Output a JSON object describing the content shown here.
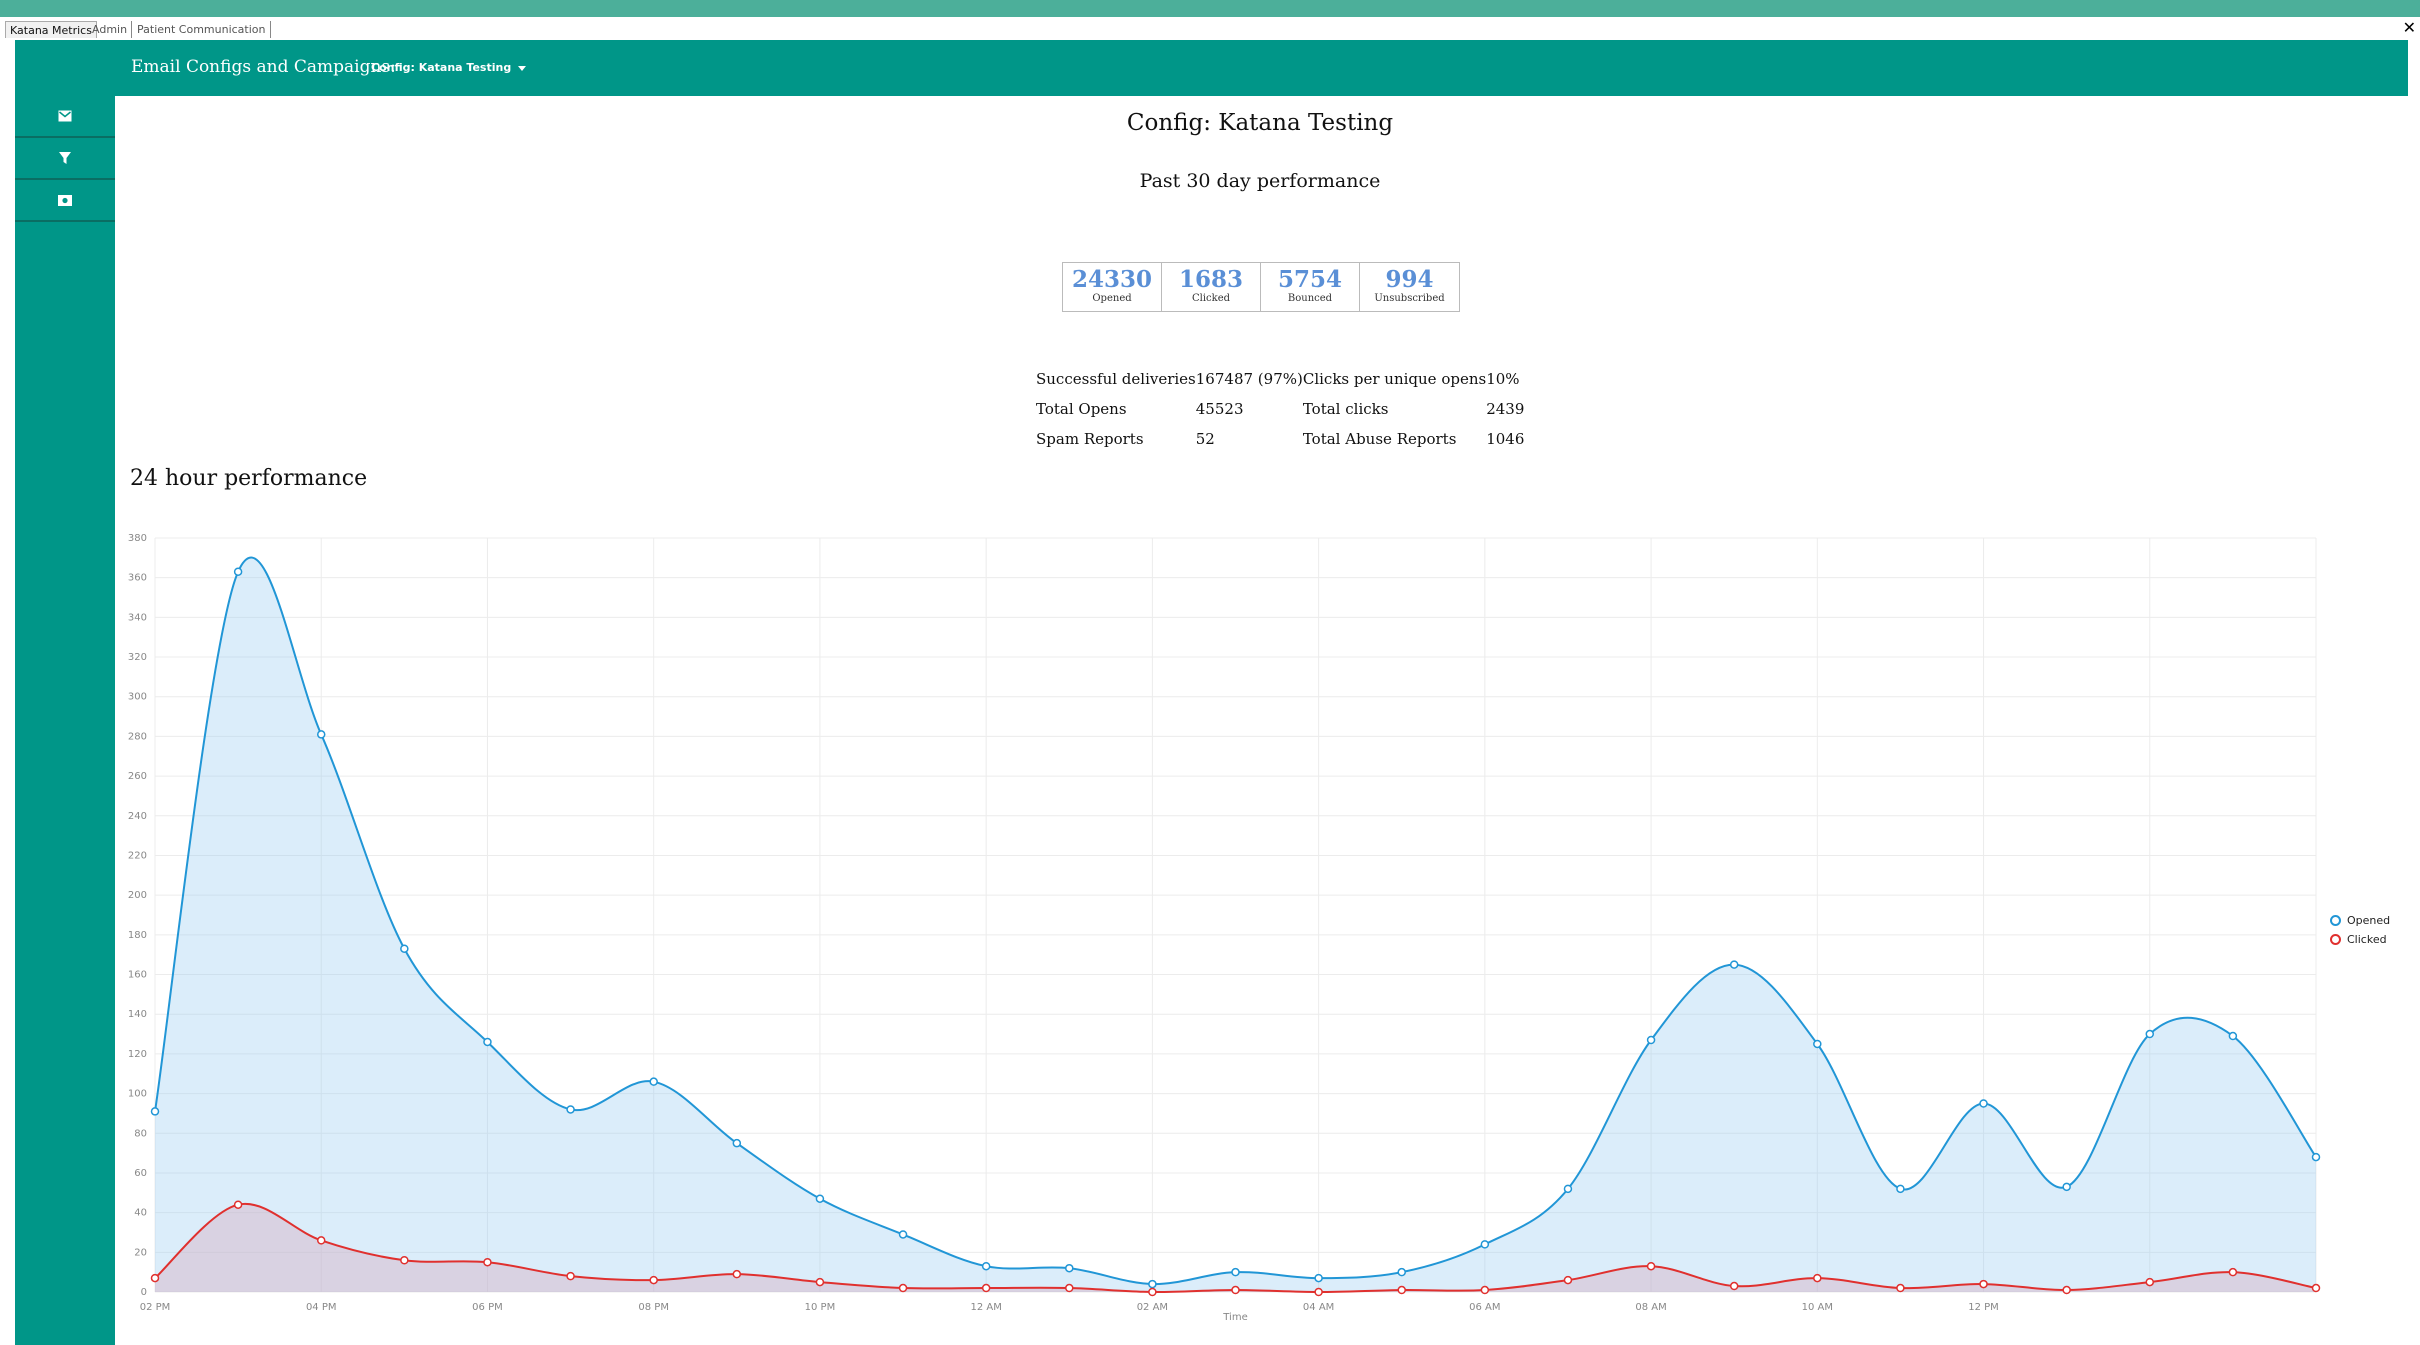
{
  "tabs": [
    {
      "label": "Katana Metrics",
      "active": true
    },
    {
      "label": "Admin",
      "active": false
    },
    {
      "label": "Patient Communication",
      "active": false
    }
  ],
  "window": {
    "close_glyph": "✕"
  },
  "header": {
    "title": "Email Configs and Campaigns:",
    "config_selector": "Config: Katana Testing"
  },
  "sidebar": {
    "items": [
      {
        "icon": "mail-icon"
      },
      {
        "icon": "filter-icon"
      },
      {
        "icon": "money-icon"
      }
    ]
  },
  "main": {
    "config_title": "Config: Katana Testing",
    "period_title": "Past 30 day performance",
    "stats": [
      {
        "value": "24330",
        "label": "Opened"
      },
      {
        "value": "1683",
        "label": "Clicked"
      },
      {
        "value": "5754",
        "label": "Bounced"
      },
      {
        "value": "994",
        "label": "Unsubscribed"
      }
    ],
    "summary": [
      [
        "Successful deliveries",
        "167487 (97%)",
        "Clicks per unique opens",
        "10%"
      ],
      [
        "Total Opens",
        "45523",
        "Total clicks",
        "2439"
      ],
      [
        "Spam Reports",
        "52",
        "Total Abuse Reports",
        "1046"
      ]
    ],
    "section_title": "24 hour performance"
  },
  "colors": {
    "accent": "#009688",
    "opened": "#2196d6",
    "clicked": "#e0302e",
    "stat_value": "#5a8fd6"
  },
  "chart_data": {
    "type": "line",
    "xlabel": "Time",
    "ylabel": "",
    "ylim": [
      0,
      380
    ],
    "yticks": [
      0,
      20,
      40,
      60,
      80,
      100,
      120,
      140,
      160,
      180,
      200,
      220,
      240,
      260,
      280,
      300,
      320,
      340,
      360,
      380
    ],
    "x_tick_labels": [
      "02 PM",
      "04 PM",
      "06 PM",
      "08 PM",
      "10 PM",
      "12 AM",
      "02 AM",
      "04 AM",
      "06 AM",
      "08 AM",
      "10 AM",
      "12 PM"
    ],
    "x_hours_from_start": [
      0,
      1,
      2,
      3,
      4,
      5,
      6,
      7,
      8,
      9,
      10,
      11,
      12,
      13,
      14,
      15,
      16,
      17,
      18,
      19,
      20,
      21,
      22,
      23,
      24,
      25,
      26
    ],
    "grid": true,
    "legend_position": "right",
    "series": [
      {
        "name": "Opened",
        "color": "#2196d6",
        "fill": "rgba(151,202,240,0.35)",
        "values": [
          91,
          363,
          281,
          173,
          126,
          92,
          106,
          75,
          47,
          29,
          13,
          12,
          4,
          10,
          7,
          10,
          24,
          52,
          127,
          165,
          125,
          52,
          95,
          53,
          130,
          129,
          68
        ]
      },
      {
        "name": "Clicked",
        "color": "#e0302e",
        "fill": "rgba(215,170,190,0.4)",
        "values": [
          7,
          44,
          26,
          16,
          15,
          8,
          6,
          9,
          5,
          2,
          2,
          2,
          0,
          1,
          0,
          1,
          1,
          6,
          13,
          3,
          7,
          2,
          4,
          1,
          5,
          10,
          2
        ]
      }
    ]
  }
}
